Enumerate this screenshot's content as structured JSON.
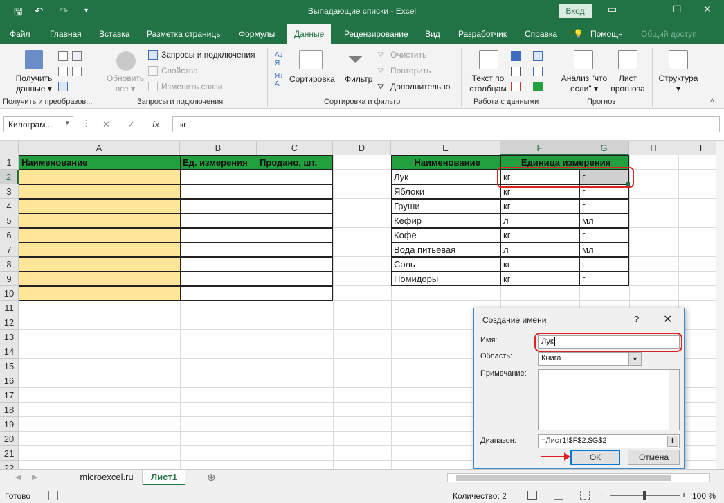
{
  "titlebar": {
    "title": "Выпадающие списки  -  Excel",
    "login": "Вход",
    "save_icon": "save-icon",
    "undo_icon": "undo-icon",
    "redo_icon": "redo-icon"
  },
  "tabs": [
    "Файл",
    "Главная",
    "Вставка",
    "Разметка страницы",
    "Формулы",
    "Данные",
    "Рецензирование",
    "Вид",
    "Разработчик",
    "Справка"
  ],
  "tab_active": "Данные",
  "help": "Помощн",
  "share": "Общий доступ",
  "ribbon": {
    "get_data_line1": "Получить",
    "get_data_line2": "данные",
    "refresh_line1": "Обновить",
    "refresh_line2": "все",
    "queries": "Запросы и подключения",
    "properties": "Свойства",
    "edit_links": "Изменить связи",
    "sort": "Сортировка",
    "filter": "Фильтр",
    "clear": "Очистить",
    "reapply": "Повторить",
    "advanced": "Дополнительно",
    "text_cols_line1": "Текст по",
    "text_cols_line2": "столбцам",
    "whatif_line1": "Анализ \"что",
    "whatif_line2": "если\"",
    "forecast_line1": "Лист",
    "forecast_line2": "прогноза",
    "outline": "Структура",
    "group_get": "Получить и преобразов...",
    "group_queries": "Запросы и подключения",
    "group_sort": "Сортировка и фильтр",
    "group_data": "Работа с данными",
    "group_forecast": "Прогноз"
  },
  "formula_bar": {
    "namebox": "Килограм...",
    "fx": "fx",
    "value": "кг"
  },
  "columns": [
    "A",
    "B",
    "C",
    "D",
    "E",
    "F",
    "G",
    "H",
    "I"
  ],
  "rows": [
    "1",
    "2",
    "3",
    "4",
    "5",
    "6",
    "7",
    "8",
    "9",
    "10",
    "11",
    "12",
    "13",
    "14",
    "15",
    "16",
    "17",
    "18",
    "19",
    "20",
    "21",
    "22"
  ],
  "table1": {
    "headers": [
      "Наименование",
      "Ед. измерения",
      "Продано, шт."
    ]
  },
  "table2": {
    "header_name": "Наименование",
    "header_unit": "Единица измерения",
    "rows": [
      [
        "Лук",
        "кг",
        "г"
      ],
      [
        "Яблоки",
        "кг",
        "г"
      ],
      [
        "Груши",
        "кг",
        "г"
      ],
      [
        "Кефир",
        "л",
        "мл"
      ],
      [
        "Кофе",
        "кг",
        "г"
      ],
      [
        "Вода питьевая",
        "л",
        "мл"
      ],
      [
        "Соль",
        "кг",
        "г"
      ],
      [
        "Помидоры",
        "кг",
        "г"
      ]
    ]
  },
  "dialog": {
    "title": "Создание имени",
    "help": "?",
    "close": "✕",
    "name_label": "Имя:",
    "name_value": "Лук",
    "scope_label": "Область:",
    "scope_value": "Книга",
    "comment_label": "Примечание:",
    "range_label": "Диапазон:",
    "range_value": "=Лист1!$F$2:$G$2",
    "ok": "ОК",
    "cancel": "Отмена"
  },
  "sheets": {
    "tab1": "microexcel.ru",
    "tab2": "Лист1"
  },
  "status": {
    "ready": "Готово",
    "count": "Количество: 2",
    "zoom": "100 %"
  },
  "colors": {
    "excel_green": "#217346",
    "header_green": "#21a03d",
    "yellow": "#ffe699",
    "highlight_red": "#dd2222"
  }
}
